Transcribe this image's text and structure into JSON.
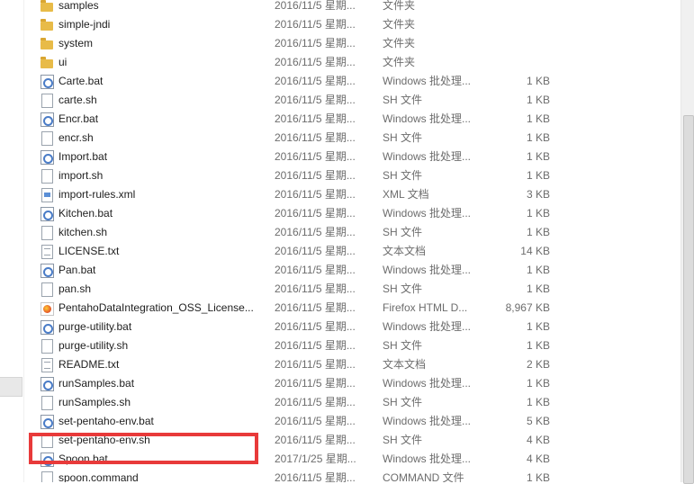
{
  "files": [
    {
      "name": "samples",
      "date": "2016/11/5 星期...",
      "type": "文件夹",
      "size": "",
      "icon": "folder-icon"
    },
    {
      "name": "simple-jndi",
      "date": "2016/11/5 星期...",
      "type": "文件夹",
      "size": "",
      "icon": "folder-icon"
    },
    {
      "name": "system",
      "date": "2016/11/5 星期...",
      "type": "文件夹",
      "size": "",
      "icon": "folder-icon"
    },
    {
      "name": "ui",
      "date": "2016/11/5 星期...",
      "type": "文件夹",
      "size": "",
      "icon": "folder-icon"
    },
    {
      "name": "Carte.bat",
      "date": "2016/11/5 星期...",
      "type": "Windows 批处理...",
      "size": "1 KB",
      "icon": "batch-file-icon"
    },
    {
      "name": "carte.sh",
      "date": "2016/11/5 星期...",
      "type": "SH 文件",
      "size": "1 KB",
      "icon": "document-icon"
    },
    {
      "name": "Encr.bat",
      "date": "2016/11/5 星期...",
      "type": "Windows 批处理...",
      "size": "1 KB",
      "icon": "batch-file-icon"
    },
    {
      "name": "encr.sh",
      "date": "2016/11/5 星期...",
      "type": "SH 文件",
      "size": "1 KB",
      "icon": "document-icon"
    },
    {
      "name": "Import.bat",
      "date": "2016/11/5 星期...",
      "type": "Windows 批处理...",
      "size": "1 KB",
      "icon": "batch-file-icon"
    },
    {
      "name": "import.sh",
      "date": "2016/11/5 星期...",
      "type": "SH 文件",
      "size": "1 KB",
      "icon": "document-icon"
    },
    {
      "name": "import-rules.xml",
      "date": "2016/11/5 星期...",
      "type": "XML 文档",
      "size": "3 KB",
      "icon": "xml-file-icon"
    },
    {
      "name": "Kitchen.bat",
      "date": "2016/11/5 星期...",
      "type": "Windows 批处理...",
      "size": "1 KB",
      "icon": "batch-file-icon"
    },
    {
      "name": "kitchen.sh",
      "date": "2016/11/5 星期...",
      "type": "SH 文件",
      "size": "1 KB",
      "icon": "document-icon"
    },
    {
      "name": "LICENSE.txt",
      "date": "2016/11/5 星期...",
      "type": "文本文档",
      "size": "14 KB",
      "icon": "text-file-icon"
    },
    {
      "name": "Pan.bat",
      "date": "2016/11/5 星期...",
      "type": "Windows 批处理...",
      "size": "1 KB",
      "icon": "batch-file-icon"
    },
    {
      "name": "pan.sh",
      "date": "2016/11/5 星期...",
      "type": "SH 文件",
      "size": "1 KB",
      "icon": "document-icon"
    },
    {
      "name": "PentahoDataIntegration_OSS_License...",
      "date": "2016/11/5 星期...",
      "type": "Firefox HTML D...",
      "size": "8,967 KB",
      "icon": "firefox-html-icon"
    },
    {
      "name": "purge-utility.bat",
      "date": "2016/11/5 星期...",
      "type": "Windows 批处理...",
      "size": "1 KB",
      "icon": "batch-file-icon"
    },
    {
      "name": "purge-utility.sh",
      "date": "2016/11/5 星期...",
      "type": "SH 文件",
      "size": "1 KB",
      "icon": "document-icon"
    },
    {
      "name": "README.txt",
      "date": "2016/11/5 星期...",
      "type": "文本文档",
      "size": "2 KB",
      "icon": "text-file-icon"
    },
    {
      "name": "runSamples.bat",
      "date": "2016/11/5 星期...",
      "type": "Windows 批处理...",
      "size": "1 KB",
      "icon": "batch-file-icon"
    },
    {
      "name": "runSamples.sh",
      "date": "2016/11/5 星期...",
      "type": "SH 文件",
      "size": "1 KB",
      "icon": "document-icon"
    },
    {
      "name": "set-pentaho-env.bat",
      "date": "2016/11/5 星期...",
      "type": "Windows 批处理...",
      "size": "5 KB",
      "icon": "batch-file-icon"
    },
    {
      "name": "set-pentaho-env.sh",
      "date": "2016/11/5 星期...",
      "type": "SH 文件",
      "size": "4 KB",
      "icon": "document-icon"
    },
    {
      "name": "Spoon.bat",
      "date": "2017/1/25 星期...",
      "type": "Windows 批处理...",
      "size": "4 KB",
      "icon": "batch-file-icon"
    },
    {
      "name": "spoon.command",
      "date": "2016/11/5 星期...",
      "type": "COMMAND 文件",
      "size": "1 KB",
      "icon": "document-icon"
    }
  ],
  "highlight_color": "#e83a3a"
}
